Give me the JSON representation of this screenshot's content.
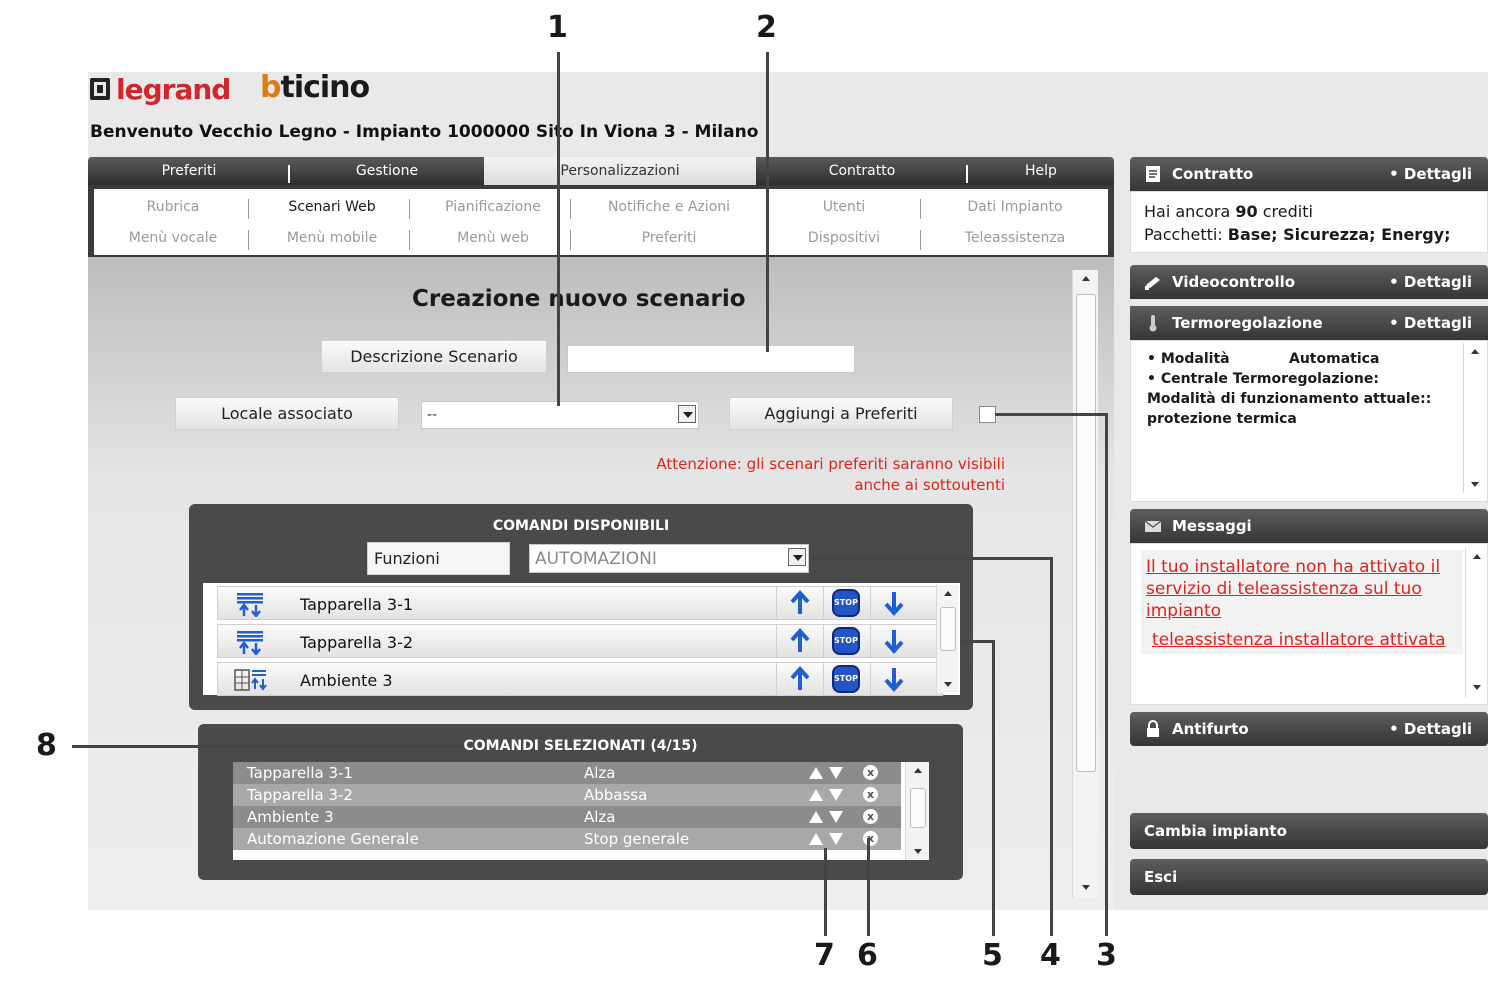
{
  "brand": {
    "logo_legrand": "legrand",
    "logo_bticino_b": "b",
    "logo_bticino_rest": "ticino"
  },
  "welcome": "Benvenuto Vecchio Legno - Impianto 1000000 Sito In Viona 3 - Milano",
  "main_tabs": [
    {
      "label": "Preferiti"
    },
    {
      "label": "Gestione"
    },
    {
      "label": "Personalizzazioni"
    },
    {
      "label": "Contratto"
    },
    {
      "label": "Help"
    }
  ],
  "submenu": {
    "row1": [
      "Rubrica",
      "Scenari Web",
      "Pianificazione",
      "Notifiche e Azioni",
      "Utenti",
      "Dati Impianto"
    ],
    "row2": [
      "Menù vocale",
      "Menù mobile",
      "Menù web",
      "Preferiti",
      "Dispositivi",
      "Teleassistenza"
    ]
  },
  "form": {
    "title": "Creazione nuovo scenario",
    "descrizione_label": "Descrizione Scenario",
    "descrizione_value": "",
    "locale_label": "Locale associato",
    "locale_value": "--",
    "aggiungi_label": "Aggiungi a Preferiti",
    "warning_line1": "Attenzione: gli scenari preferiti saranno visibili",
    "warning_line2": "anche ai sottoutenti"
  },
  "comandi_disponibili": {
    "title": "COMANDI DISPONIBILI",
    "funzioni_label": "Funzioni",
    "funzioni_value": "AUTOMAZIONI",
    "stop_label": "STOP",
    "items": [
      {
        "name": "Tapparella 3-1",
        "icon": "shutter-icon"
      },
      {
        "name": "Tapparella 3-2",
        "icon": "shutter-icon"
      },
      {
        "name": "Ambiente 3",
        "icon": "room-shutter-icon"
      }
    ]
  },
  "comandi_selezionati": {
    "title": "COMANDI SELEZIONATI (4/15)",
    "remove_glyph": "x",
    "rows": [
      {
        "comando": "Tapparella 3-1",
        "azione": "Alza"
      },
      {
        "comando": "Tapparella 3-2",
        "azione": "Abbassa"
      },
      {
        "comando": "Ambiente 3",
        "azione": "Alza"
      },
      {
        "comando": "Automazione Generale",
        "azione": "Stop generale"
      }
    ]
  },
  "sidebar": {
    "dettagli": "• Dettagli",
    "contratto": {
      "title": "Contratto",
      "line1_pre": "Hai ancora ",
      "credits": "90",
      "line1_post": " crediti",
      "pacchetti_label": "Pacchetti: ",
      "pacchetti_value": "Base; Sicurezza; Energy;"
    },
    "videocontrollo": {
      "title": "Videocontrollo"
    },
    "termoregolazione": {
      "title": "Termoregolazione",
      "modalita_label": "• Modalità",
      "modalita_value": "Automatica",
      "centrale": "• Centrale Termoregolazione:",
      "funzionamento": "Modalità di funzionamento attuale::",
      "protezione": "protezione termica"
    },
    "messaggi": {
      "title": "Messaggi",
      "msg1": "Il tuo installatore non ha attivato il servizio di teleassistenza sul tuo impianto",
      "msg2": "teleassistenza installatore attivata"
    },
    "antifurto": {
      "title": "Antifurto"
    },
    "cambia_impianto": "Cambia impianto",
    "esci": "Esci"
  },
  "callouts": [
    "1",
    "2",
    "3",
    "4",
    "5",
    "6",
    "7",
    "8"
  ],
  "colors": {
    "warning": "#e2231a",
    "legrand_red": "#d0262c",
    "bticino_orange": "#e07b10",
    "stop_blue": "#2554c7",
    "arrow_blue": "#1f5fd6"
  }
}
